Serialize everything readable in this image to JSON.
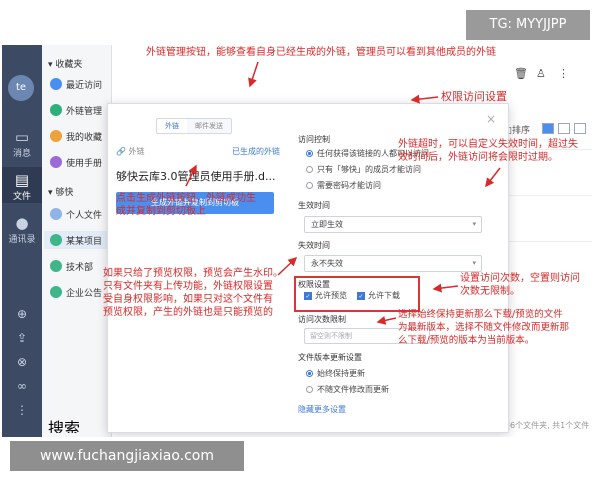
{
  "watermark_tag": "TG: MYYJJPP",
  "footer_url": "www.fuchangjiaxiao.com",
  "rail": {
    "avatar": "te",
    "nav": [
      {
        "label": "消息",
        "icon": "chat-icon"
      },
      {
        "label": "文件",
        "icon": "file-icon"
      },
      {
        "label": "通讯录",
        "icon": "contacts-icon"
      }
    ]
  },
  "sidebar": {
    "favorites_title": "收藏夹",
    "favorites": [
      {
        "label": "最近访问",
        "color": "#4a8ff0"
      },
      {
        "label": "外链管理",
        "color": "#2fb07a"
      },
      {
        "label": "我的收藏",
        "color": "#f0a23a"
      },
      {
        "label": "使用手册",
        "color": "#9b6ad6"
      }
    ],
    "quick_title": "够快",
    "quick": [
      {
        "label": "个人文件",
        "color": "#8fb4e8"
      },
      {
        "label": "某某项目",
        "color": "#3fb58a"
      },
      {
        "label": "技术部",
        "color": "#3fb58a"
      },
      {
        "label": "企业公告",
        "color": "#3fb58a"
      }
    ],
    "search_placeholder": "搜索"
  },
  "content": {
    "sort_label": "排序",
    "status": "共6个文件夹, 共1个文件"
  },
  "dialog": {
    "tabs": [
      "外链",
      "邮件发送"
    ],
    "link_label": "外链",
    "generated_label": "已生成的外链",
    "doc_name": "够快云库3.0管理员使用手册.d...",
    "generate_button": "生成外链并复制到剪切板",
    "access_title": "访问控制",
    "access_options": [
      "任何获得该链接的人都可以访问",
      "只有「够快」的成员才能访问",
      "需要密码才能访问"
    ],
    "effective_title": "生效时间",
    "effective_value": "立即生效",
    "expire_title": "失效时间",
    "expire_value": "永不失效",
    "permission_title": "权限设置",
    "permissions": [
      "允许预览",
      "允许下载"
    ],
    "limit_title": "访问次数限制",
    "limit_placeholder": "留空则不限制",
    "version_title": "文件版本更新设置",
    "version_options": [
      "始终保持更新",
      "不随文件修改而更新"
    ],
    "more_link": "隐藏更多设置"
  },
  "annotations": {
    "top": "外链管理按钮，能够查看自身已经生成的外链，管理员可以看到其他成员的外链",
    "permission_setting": "权限访问设置",
    "timeout": [
      "外链超时，可以自定义失效时间，超过失",
      "效时间后，外链访问将会限时过期。"
    ],
    "generate": [
      "点击生成外链按钮，外链成功生",
      "成并复制到剪切板上"
    ],
    "preview": [
      "如果只给了预览权限，预览会产生水印。",
      "只有文件夹有上传功能，外链权限设置",
      "受自身权限影响，如果只对这个文件有",
      "预览权限，产生的外链也是只能预览的"
    ],
    "visit_count": [
      "设置访问次数，空置则访问",
      "次数无限制。"
    ],
    "version": [
      "选择始终保持更新那么下载/预览的文件",
      "为最新版本，选择不随文件修改而更新那",
      "么下载/预览的版本为当前版本。"
    ]
  },
  "colors": {
    "annotation_red": "#d82a2a",
    "accent_blue": "#4a8ff0",
    "rail_bg": "#3c4a64"
  }
}
